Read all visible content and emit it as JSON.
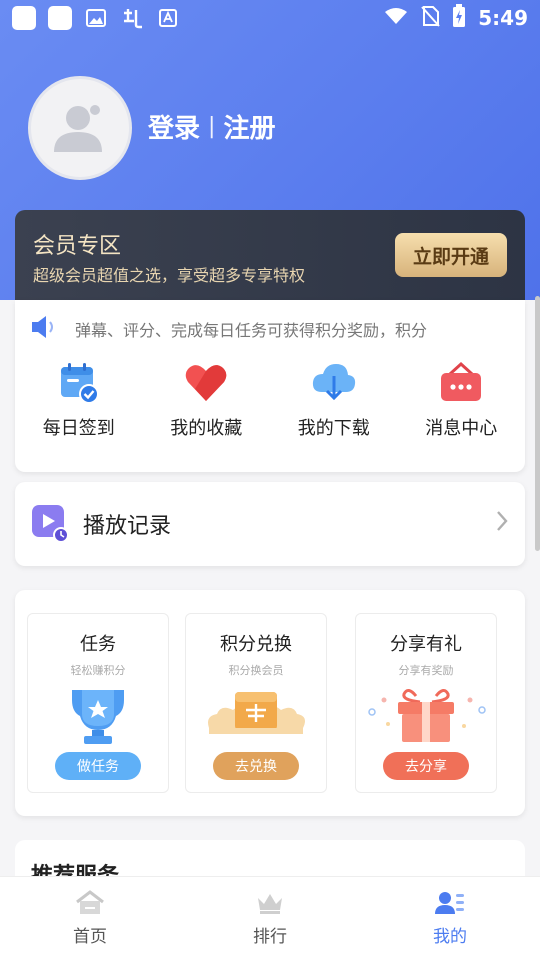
{
  "status_bar": {
    "time": "5:49"
  },
  "profile": {
    "login": "登录",
    "separator": "|",
    "register": "注册"
  },
  "vip": {
    "title": "会员专区",
    "subtitle": "超级会员超值之选，享受超多专享特权",
    "button": "立即开通"
  },
  "notice": {
    "text": "弹幕、评分、完成每日任务可获得积分奖励，积分"
  },
  "quick_actions": [
    {
      "label": "每日签到",
      "icon": "calendar-check-icon"
    },
    {
      "label": "我的收藏",
      "icon": "heart-icon"
    },
    {
      "label": "我的下载",
      "icon": "cloud-download-icon"
    },
    {
      "label": "消息中心",
      "icon": "message-bag-icon"
    }
  ],
  "history": {
    "label": "播放记录"
  },
  "points": [
    {
      "title": "任务",
      "subtitle": "轻松赚积分",
      "button": "做任务",
      "color": "#5fb0f7"
    },
    {
      "title": "积分兑换",
      "subtitle": "积分换会员",
      "button": "去兑换",
      "color": "#e0a25c"
    },
    {
      "title": "分享有礼",
      "subtitle": "分享有奖励",
      "button": "去分享",
      "color": "#f07058"
    }
  ],
  "recommend": {
    "title": "推荐服务"
  },
  "tabs": [
    {
      "label": "首页",
      "active": false
    },
    {
      "label": "排行",
      "active": false
    },
    {
      "label": "我的",
      "active": true
    }
  ],
  "colors": {
    "accent": "#4c7cf0",
    "hero": "#5a7ef0",
    "vip_dark": "#343a4a"
  }
}
